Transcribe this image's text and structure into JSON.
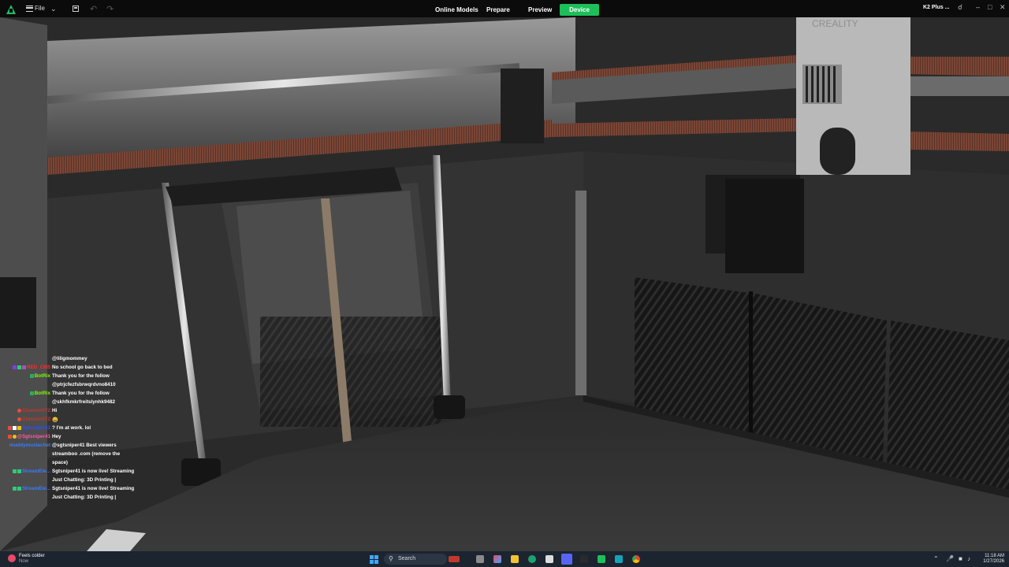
{
  "app": {
    "file_menu": "File",
    "tabs": [
      "Online Models",
      "Prepare",
      "Preview",
      "Device"
    ],
    "active_tab": "Device",
    "device_name": "K2 Plus ...",
    "accent_color": "#1dbf5a"
  },
  "feed": {
    "printer_brand_text": "CREALITY"
  },
  "chat": [
    {
      "user": "",
      "user_color": "#ffffff",
      "message": "@liligmommey"
    },
    {
      "user": "RED_CBS",
      "user_color": "#ff2a2a",
      "message": "No school go back to bed"
    },
    {
      "user": "BotRix",
      "user_color": "#7CFC00",
      "message": "Thank you for the follow"
    },
    {
      "user": "",
      "user_color": "#ffffff",
      "message": "@ptrjcfezfsbrwqrdvno8410"
    },
    {
      "user": "BotRix",
      "user_color": "#7CFC00",
      "message": "Thank you for the follow"
    },
    {
      "user": "",
      "user_color": "#ffffff",
      "message": "@skhfkmkrfreitslynhk9482"
    },
    {
      "user": "ClumsinV72",
      "user_color": "#c0392b",
      "message": "Hi"
    },
    {
      "user": "ClumsinV72",
      "user_color": "#c0392b",
      "message": "😀"
    },
    {
      "user": "Sgtsniper41",
      "user_color": "#2f4fff",
      "message": "? I'm at work. lol"
    },
    {
      "user": "@Sgtsniper41",
      "user_color": "#ff55aa",
      "message": "Hey"
    },
    {
      "user": "muddymustachet",
      "user_color": "#3a7bff",
      "message": "@sgtsniper41 Best viewers"
    },
    {
      "user": "",
      "user_color": "#ffffff",
      "message": "streamboo .com (remove the"
    },
    {
      "user": "",
      "user_color": "#ffffff",
      "message": "space)"
    },
    {
      "user": "StreamEle...",
      "user_color": "#3a7bff",
      "message": "Sgtsniper41 is now live! Streaming"
    },
    {
      "user": "",
      "user_color": "#ffffff",
      "message": "Just Chatting: 3D Printing |"
    },
    {
      "user": "StreamEle...",
      "user_color": "#3a7bff",
      "message": "Sgtsniper41 is now live! Streaming"
    },
    {
      "user": "",
      "user_color": "#ffffff",
      "message": "Just Chatting: 3D Printing |"
    }
  ],
  "taskbar": {
    "weather_title": "Feels colder",
    "weather_sub": "Now",
    "search_placeholder": "Search",
    "time": "11:18 AM",
    "date": "1/27/2026"
  }
}
